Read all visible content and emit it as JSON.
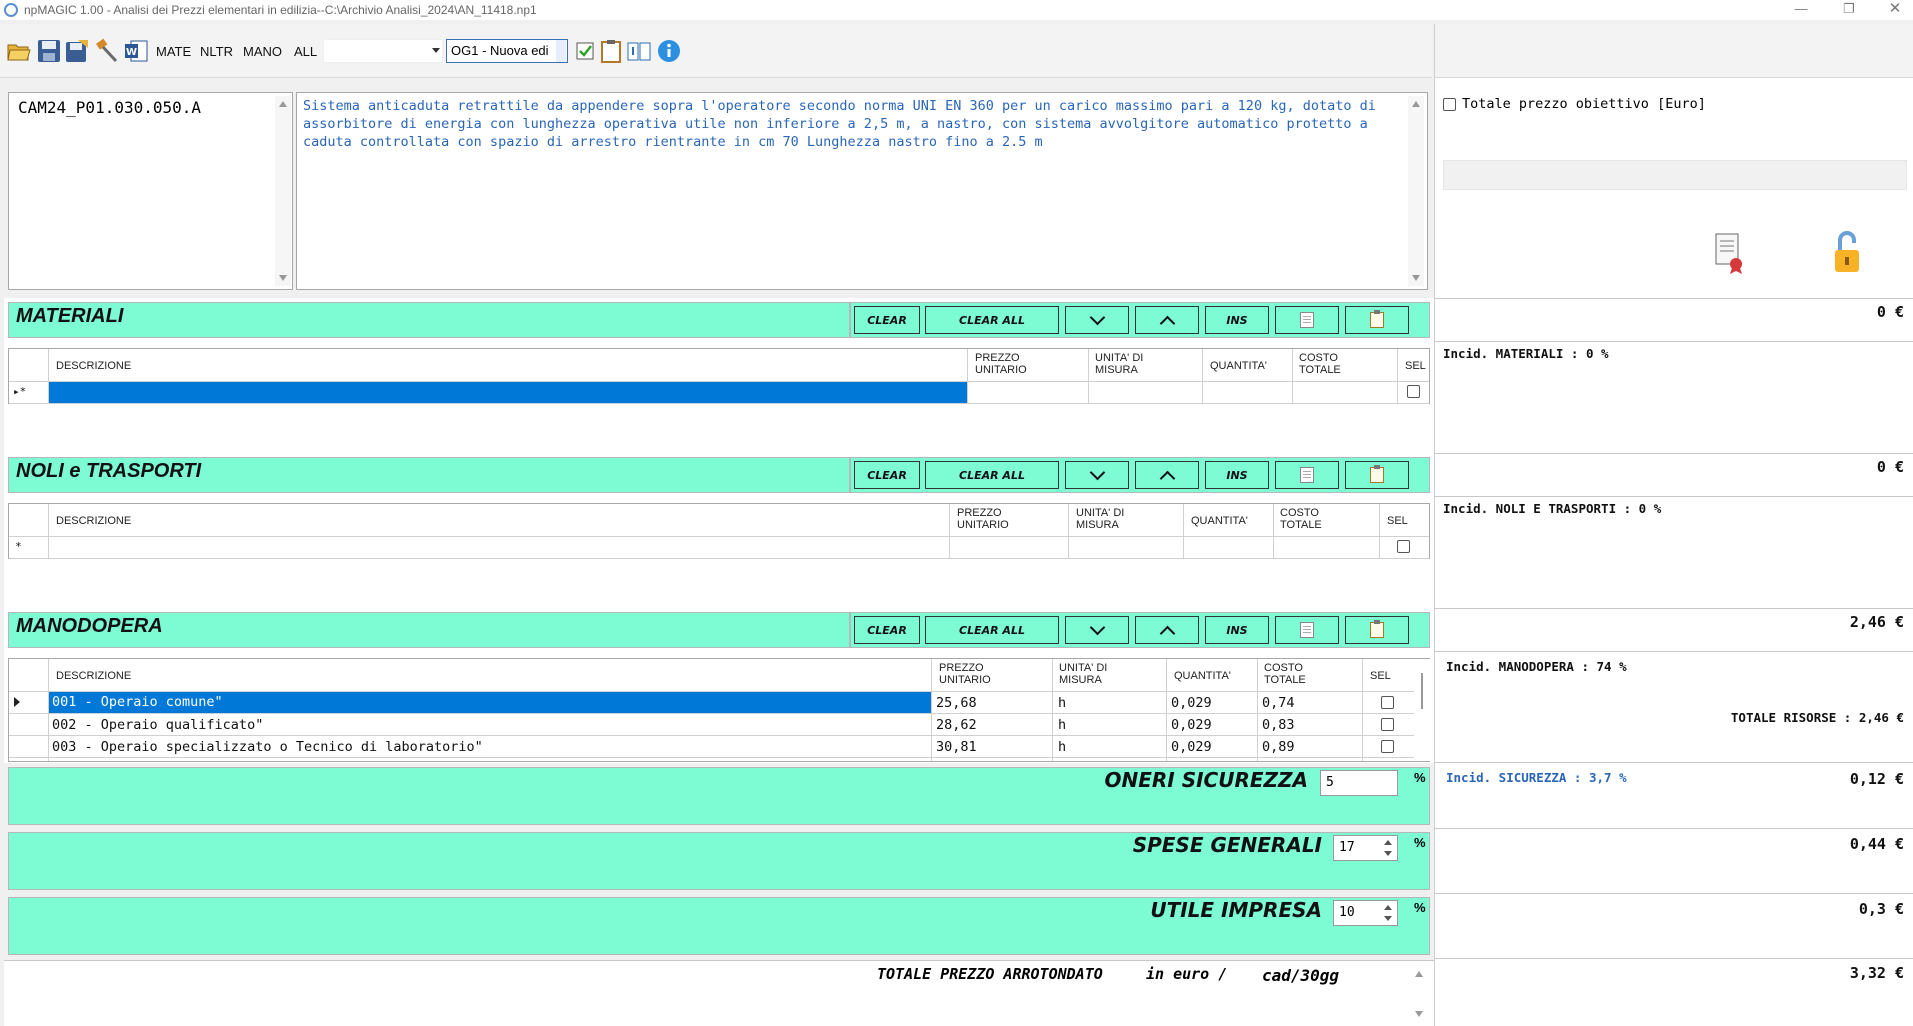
{
  "window": {
    "title": "npMAGIC 1.00 - Analisi dei Prezzi elementari in edilizia--C:\\Archivio Analisi_2024\\AN_11418.np1"
  },
  "toolbar": {
    "text_buttons": [
      "MATE",
      "NLTR",
      "MANO",
      "ALL"
    ],
    "filter_value": "",
    "category_value": "OG1 - Nuova edi"
  },
  "article": {
    "code": "CAM24_P01.030.050.A",
    "description": "Sistema anticaduta retrattile da appendere sopra l'operatore secondo norma UNI EN 360 per un  carico massimo pari a 120 kg, dotato di assorbitore di energia con lunghezza operativa utile non inferiore a 2,5 m, a nastro, con sistema avvolgitore automatico protetto a caduta controllata con spazio di arrestro rientrante in cm 70  Lunghezza nastro fino a 2.5 m"
  },
  "right_panel": {
    "target_checkbox_label": "Totale prezzo obiettivo [Euro]",
    "target_value": ""
  },
  "section_buttons": [
    "CLEAR",
    "CLEAR ALL",
    "",
    "",
    "INS",
    "",
    ""
  ],
  "grid_headers": {
    "desc": "DESCRIZIONE",
    "price": [
      "PREZZO",
      "UNITARIO"
    ],
    "unit": [
      "UNITA' DI",
      "MISURA"
    ],
    "qty": "QUANTITA'",
    "cost": [
      "COSTO",
      "TOTALE"
    ],
    "sel": "SEL"
  },
  "materiali": {
    "title": "MATERIALI",
    "total": "0 €",
    "incid": "Incid. MATERIALI : 0 %",
    "row_marker": "▸*"
  },
  "noli": {
    "title": "NOLI e TRASPORTI",
    "total": "0 €",
    "incid": "Incid. NOLI E TRASPORTI : 0 %",
    "row_marker": "*"
  },
  "manodopera": {
    "title": "MANODOPERA",
    "total": "2,46 €",
    "incid": "Incid. MANODOPERA : 74 %",
    "totale_risorse": "TOTALE RISORSE : 2,46 €",
    "rows": [
      {
        "desc": "001 - Operaio comune\"",
        "price": "25,68",
        "unit": "h",
        "qty": "0,029",
        "cost": "0,74"
      },
      {
        "desc": "002 - Operaio qualificato\"",
        "price": "28,62",
        "unit": "h",
        "qty": "0,029",
        "cost": "0,83"
      },
      {
        "desc": "003 - Operaio specializzato o Tecnico di laboratorio\"",
        "price": "30,81",
        "unit": "h",
        "qty": "0,029",
        "cost": "0,89"
      }
    ]
  },
  "oneri": {
    "label": "ONERI SICUREZZA",
    "value": "5",
    "pct": "%",
    "incid": "Incid. SICUREZZA : 3,7 %",
    "total": "0,12 €"
  },
  "spese": {
    "label": "SPESE GENERALI",
    "value": "17",
    "pct": "%",
    "total": "0,44 €"
  },
  "utile": {
    "label": "UTILE IMPRESA",
    "value": "10",
    "pct": "%",
    "total": "0,3 €"
  },
  "totale": {
    "label": "TOTALE PREZZO ARROTONDATO",
    "in_euro": "in euro /",
    "unit": "cad/30gg",
    "total": "3,32 €"
  },
  "colors": {
    "section": "#7dfbd3",
    "selection": "#0078d7",
    "desc_text": "#2a66b8"
  }
}
